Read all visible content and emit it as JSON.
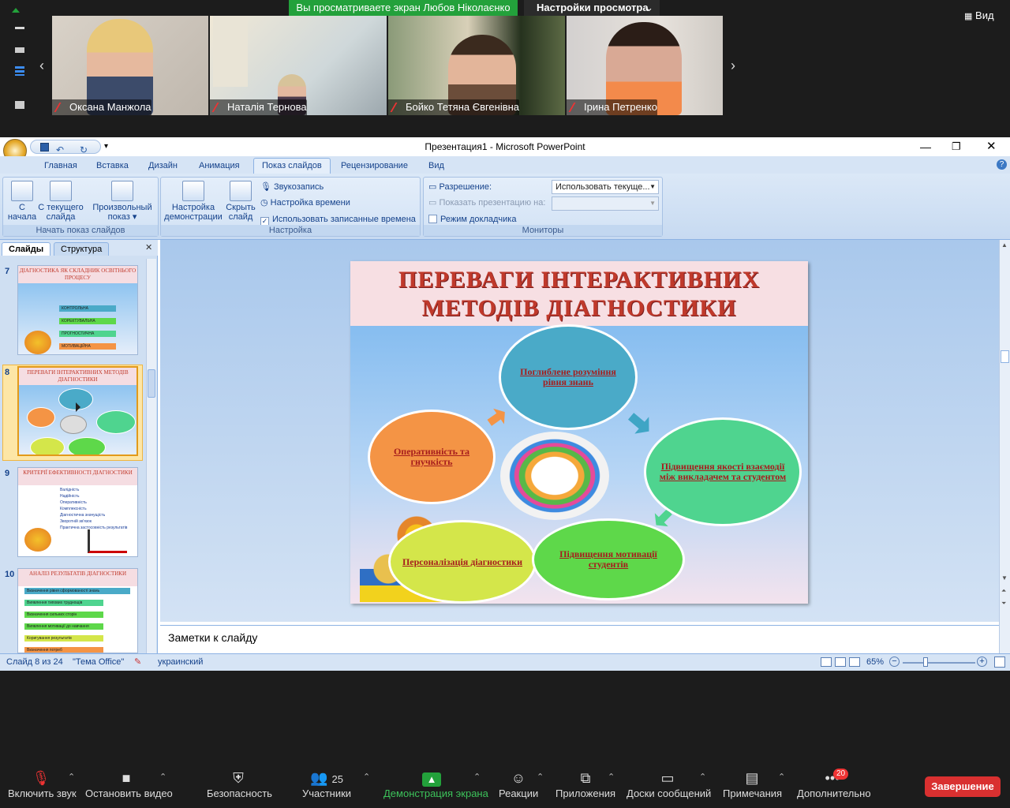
{
  "zoom": {
    "share_banner": "Вы просматриваете экран Любов Ніколаєнко",
    "view_settings": "Настройки просмотра",
    "view_button": "Вид",
    "participants": [
      {
        "name": "Оксана Манжола"
      },
      {
        "name": "Наталія Тернова"
      },
      {
        "name": "Бойко Тетяна Євгенівна"
      },
      {
        "name": "Ірина Петренко"
      }
    ],
    "toolbar": {
      "mute": "Включить звук",
      "video": "Остановить видео",
      "security": "Безопасность",
      "participants": "Участники",
      "participants_count": "25",
      "share": "Демонстрация экрана",
      "reactions": "Реакции",
      "apps": "Приложения",
      "whiteboards": "Доски сообщений",
      "notes": "Примечания",
      "more": "Дополнительно",
      "more_badge": "20",
      "end": "Завершение"
    },
    "colors": {
      "share_green": "#23a13b",
      "end_red": "#d93030"
    }
  },
  "ppt": {
    "title": "Презентация1 - Microsoft PowerPoint",
    "tabs": [
      "Главная",
      "Вставка",
      "Дизайн",
      "Анимация",
      "Показ слайдов",
      "Рецензирование",
      "Вид"
    ],
    "active_tab": "Показ слайдов",
    "ribbon": {
      "from_start": "С начала",
      "from_current": "С текущего слайда",
      "custom_show": "Произвольный показ",
      "group_start": "Начать показ слайдов",
      "setup_show": "Настройка демонстрации",
      "hide_slide": "Скрыть слайд",
      "record_narration": "Звукозапись",
      "rehearse": "Настройка времени",
      "use_timings": "Использовать записанные времена",
      "group_setup": "Настройка",
      "resolution_label": "Разрешение:",
      "resolution_value": "Использовать текуще...",
      "show_on_label": "Показать презентацию на:",
      "presenter_view": "Режим докладчика",
      "group_monitors": "Мониторы"
    },
    "panel": {
      "tab_slides": "Слайды",
      "tab_outline": "Структура",
      "thumbs": [
        {
          "num": "7",
          "title": "ДІАГНОСТИКА ЯК СКЛАДНИК ОСВІТНЬОГО ПРОЦЕСУ",
          "bars": [
            "КОНТРОЛЬНА",
            "КОРЕКТУВАЛЬНА",
            "ПРОГНОСТИЧНА",
            "МОТИВАЦІЙНА"
          ]
        },
        {
          "num": "8",
          "title": "ПЕРЕВАГИ ІНТЕРАКТИВНИХ МЕТОДІВ ДІАГНОСТИКИ"
        },
        {
          "num": "9",
          "title": "КРИТЕРІЇ ЕФЕКТИВНОСТІ ДІАГНОСТИКИ",
          "bars": [
            "Валідність",
            "Надійність",
            "Оперативність",
            "Комплексність",
            "Діагностична значущість",
            "Зворотній зв'язок",
            "Практична застосовність результатів"
          ]
        },
        {
          "num": "10",
          "title": "АНАЛІЗ РЕЗУЛЬТАТІВ ДІАГНОСТИКИ",
          "bars": [
            "Визначення рівня сформованості знань",
            "Виявлення типових труднощів",
            "Визначення сильних сторін",
            "Виявлення мотивації до навчання",
            "Коригування результатів",
            "Визначення потреб"
          ]
        }
      ]
    },
    "slide": {
      "title_line1": "ПЕРЕВАГИ ІНТЕРАКТИВНИХ",
      "title_line2": "МЕТОДІВ ДІАГНОСТИКИ",
      "ovals": {
        "top": "Поглиблене розуміння рівня знань",
        "left": "Оперативність та гнучкість",
        "right": "Підвищення якості взаємодії між викладачем та студентом",
        "bottom_left": "Персоналізація діагностики",
        "bottom_right": "Підвищення мотивації студентів"
      },
      "colors": {
        "title": "#c0392b",
        "top": "#4aaac8",
        "left": "#f49445",
        "right": "#4fd48f",
        "bottom_left": "#d4e64a",
        "bottom_right": "#5ed84a"
      }
    },
    "notes_placeholder": "Заметки к слайду",
    "status": {
      "slide": "Слайд 8 из 24",
      "theme": "\"Тема Office\"",
      "language": "украинский",
      "zoom": "65%"
    }
  }
}
